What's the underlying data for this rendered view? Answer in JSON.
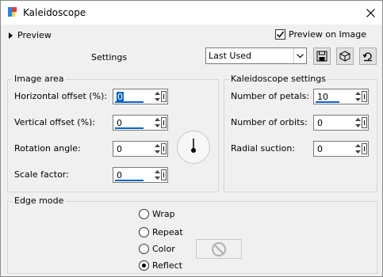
{
  "window": {
    "title": "Kaleidoscope"
  },
  "header": {
    "preview_label": "Preview",
    "preview_on_image_label": "Preview on Image",
    "preview_on_image_checked": true
  },
  "settings": {
    "label": "Settings",
    "preset_value": "Last Used",
    "buttons": [
      "save-preset-icon",
      "randomize-icon",
      "reset-icon"
    ]
  },
  "image_area": {
    "title": "Image area",
    "horizontal_offset": {
      "label": "Horizontal offset (%):",
      "value": "0"
    },
    "vertical_offset": {
      "label": "Vertical offset (%):",
      "value": "0"
    },
    "rotation_angle": {
      "label": "Rotation angle:",
      "value": "0"
    },
    "scale_factor": {
      "label": "Scale factor:",
      "value": "0"
    }
  },
  "kaleidoscope_settings": {
    "title": "Kaleidoscope settings",
    "petals": {
      "label": "Number of petals:",
      "value": "10"
    },
    "orbits": {
      "label": "Number of orbits:",
      "value": "0"
    },
    "radial_suction": {
      "label": "Radial suction:",
      "value": "0"
    }
  },
  "edge_mode": {
    "title": "Edge mode",
    "options": [
      "Wrap",
      "Repeat",
      "Color",
      "Reflect"
    ],
    "selected": "Reflect"
  }
}
